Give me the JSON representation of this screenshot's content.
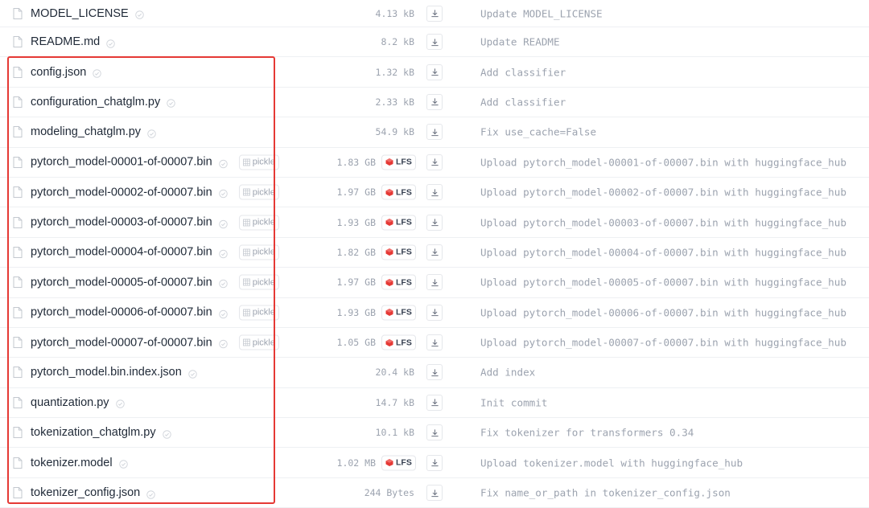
{
  "files": [
    {
      "name": "MODEL_LICENSE",
      "size": "4.13 kB",
      "lfs": false,
      "pickle": false,
      "commit": "Update MODEL_LICENSE"
    },
    {
      "name": "README.md",
      "size": "8.2 kB",
      "lfs": false,
      "pickle": false,
      "commit": "Update README"
    },
    {
      "name": "config.json",
      "size": "1.32 kB",
      "lfs": false,
      "pickle": false,
      "commit": "Add classifier"
    },
    {
      "name": "configuration_chatglm.py",
      "size": "2.33 kB",
      "lfs": false,
      "pickle": false,
      "commit": "Add classifier"
    },
    {
      "name": "modeling_chatglm.py",
      "size": "54.9 kB",
      "lfs": false,
      "pickle": false,
      "commit": "Fix use_cache=False"
    },
    {
      "name": "pytorch_model-00001-of-00007.bin",
      "size": "1.83 GB",
      "lfs": true,
      "pickle": true,
      "commit": "Upload pytorch_model-00001-of-00007.bin with huggingface_hub"
    },
    {
      "name": "pytorch_model-00002-of-00007.bin",
      "size": "1.97 GB",
      "lfs": true,
      "pickle": true,
      "commit": "Upload pytorch_model-00002-of-00007.bin with huggingface_hub"
    },
    {
      "name": "pytorch_model-00003-of-00007.bin",
      "size": "1.93 GB",
      "lfs": true,
      "pickle": true,
      "commit": "Upload pytorch_model-00003-of-00007.bin with huggingface_hub"
    },
    {
      "name": "pytorch_model-00004-of-00007.bin",
      "size": "1.82 GB",
      "lfs": true,
      "pickle": true,
      "commit": "Upload pytorch_model-00004-of-00007.bin with huggingface_hub"
    },
    {
      "name": "pytorch_model-00005-of-00007.bin",
      "size": "1.97 GB",
      "lfs": true,
      "pickle": true,
      "commit": "Upload pytorch_model-00005-of-00007.bin with huggingface_hub"
    },
    {
      "name": "pytorch_model-00006-of-00007.bin",
      "size": "1.93 GB",
      "lfs": true,
      "pickle": true,
      "commit": "Upload pytorch_model-00006-of-00007.bin with huggingface_hub"
    },
    {
      "name": "pytorch_model-00007-of-00007.bin",
      "size": "1.05 GB",
      "lfs": true,
      "pickle": true,
      "commit": "Upload pytorch_model-00007-of-00007.bin with huggingface_hub"
    },
    {
      "name": "pytorch_model.bin.index.json",
      "size": "20.4 kB",
      "lfs": false,
      "pickle": false,
      "commit": "Add index"
    },
    {
      "name": "quantization.py",
      "size": "14.7 kB",
      "lfs": false,
      "pickle": false,
      "commit": "Init commit"
    },
    {
      "name": "tokenization_chatglm.py",
      "size": "10.1 kB",
      "lfs": false,
      "pickle": false,
      "commit": "Fix tokenizer for transformers 0.34"
    },
    {
      "name": "tokenizer.model",
      "size": "1.02 MB",
      "lfs": true,
      "pickle": false,
      "commit": "Upload tokenizer.model with huggingface_hub"
    },
    {
      "name": "tokenizer_config.json",
      "size": "244 Bytes",
      "lfs": false,
      "pickle": false,
      "commit": "Fix name_or_path in tokenizer_config.json"
    }
  ],
  "labels": {
    "pickle": "pickle",
    "lfs": "LFS"
  },
  "colors": {
    "highlight": "#e53935",
    "lfs_icon": "#e53935",
    "muted_text": "#9ca3af"
  },
  "icons": {
    "file": "file-icon",
    "safe": "safe-check-icon",
    "download": "download-icon",
    "lfs": "lfs-cube-icon",
    "pickle": "pickle-grid-icon"
  },
  "annotation": {
    "highlighted_rows_from": "config.json",
    "highlighted_rows_to": "tokenizer_config.json"
  }
}
